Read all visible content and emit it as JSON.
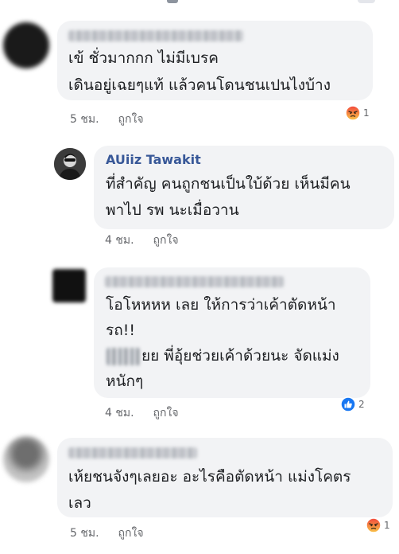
{
  "comments": [
    {
      "author": "",
      "lines": [
        "เข้ ชั่วมากกก ไม่มีเบรค",
        "เดินอยู่เฉยๆแท้ แล้วคนโดนชนเปนไงบ้าง"
      ],
      "time": "5 ชม.",
      "like_label": "ถูกใจ",
      "reaction_icon": "angry-reaction-icon",
      "reaction_count": "1"
    },
    {
      "author": "AUiiz Tawakit",
      "lines": [
        "ที่สำคัญ คนถูกชนเป็นใบ้ด้วย เห็นมีคน",
        "พาไป รพ นะเมื่อวาน"
      ],
      "time": "4 ชม.",
      "like_label": "ถูกใจ"
    },
    {
      "author": "",
      "lines": [
        "โอโหหหห เลย ให้การว่าเค้าตัดหน้า",
        "รถ!!",
        "ยย พี่อุ้ยช่วยเค้าด้วยนะ จัดแม่ง",
        "หนักๆ"
      ],
      "time": "4 ชม.",
      "like_label": "ถูกใจ",
      "reaction_icon": "like-reaction-icon",
      "reaction_count": "2"
    },
    {
      "author": "",
      "lines": [
        "เห้ยชนจังๆเลยอะ อะไรคือตัดหน้า แม่งโคตร",
        "เลว"
      ],
      "time": "5 ชม.",
      "like_label": "ถูกใจ",
      "reaction_icon": "angry-reaction-icon",
      "reaction_count": "1"
    }
  ],
  "colors": {
    "bubble": "#f2f3f5",
    "name_link": "#385898",
    "meta_text": "#65676b",
    "like_blue": "#1877f2",
    "angry_orange": "#f7714c"
  }
}
